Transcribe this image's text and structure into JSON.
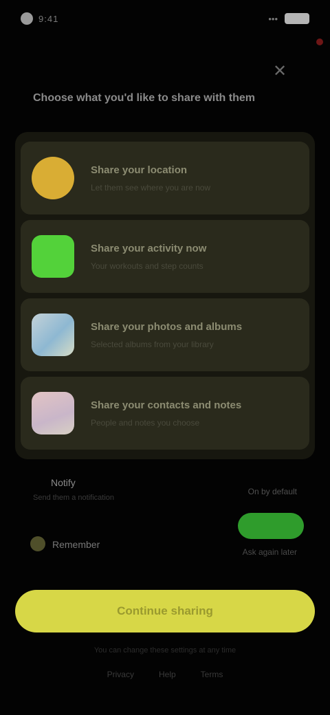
{
  "status_bar": {
    "time": "9:41",
    "signal": "•••"
  },
  "header": {
    "close_glyph": "✕",
    "title": "Choose what you'd like to share with them"
  },
  "cards": [
    {
      "title": "Share your location",
      "subtitle": "Let them see where you are now"
    },
    {
      "title": "Share your activity now",
      "subtitle": "Your workouts and step counts"
    },
    {
      "title": "Share your photos and albums",
      "subtitle": "Selected albums from your library"
    },
    {
      "title": "Share your contacts and notes",
      "subtitle": "People and notes you choose"
    }
  ],
  "options": {
    "notify_label": "Notify",
    "notify_sub": "Send them a notification",
    "notify_right": "On by default",
    "remember_label": "Remember",
    "remember_right": "Ask again later"
  },
  "primary_button": {
    "label": "Continue sharing"
  },
  "footer": {
    "note": "You can change these settings at any time",
    "links": [
      "Privacy",
      "Help",
      "Terms"
    ]
  },
  "colors": {
    "accent": "#d7d747",
    "toggle_on": "#2f9c2c"
  }
}
